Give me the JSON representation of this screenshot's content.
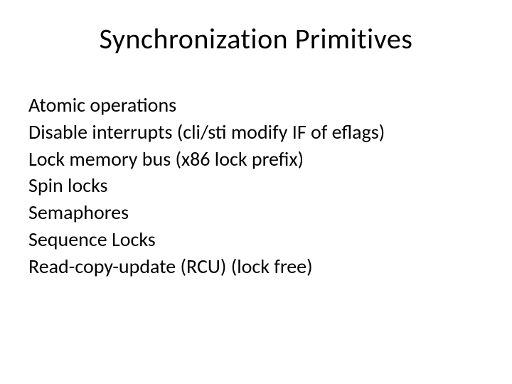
{
  "slide": {
    "title": "Synchronization Primitives",
    "items": [
      "Atomic operations",
      "Disable interrupts (cli/sti modify IF of eflags)",
      "Lock memory bus (x86 lock prefix)",
      "Spin locks",
      "Semaphores",
      "Sequence Locks",
      "Read-copy-update (RCU) (lock free)"
    ]
  }
}
